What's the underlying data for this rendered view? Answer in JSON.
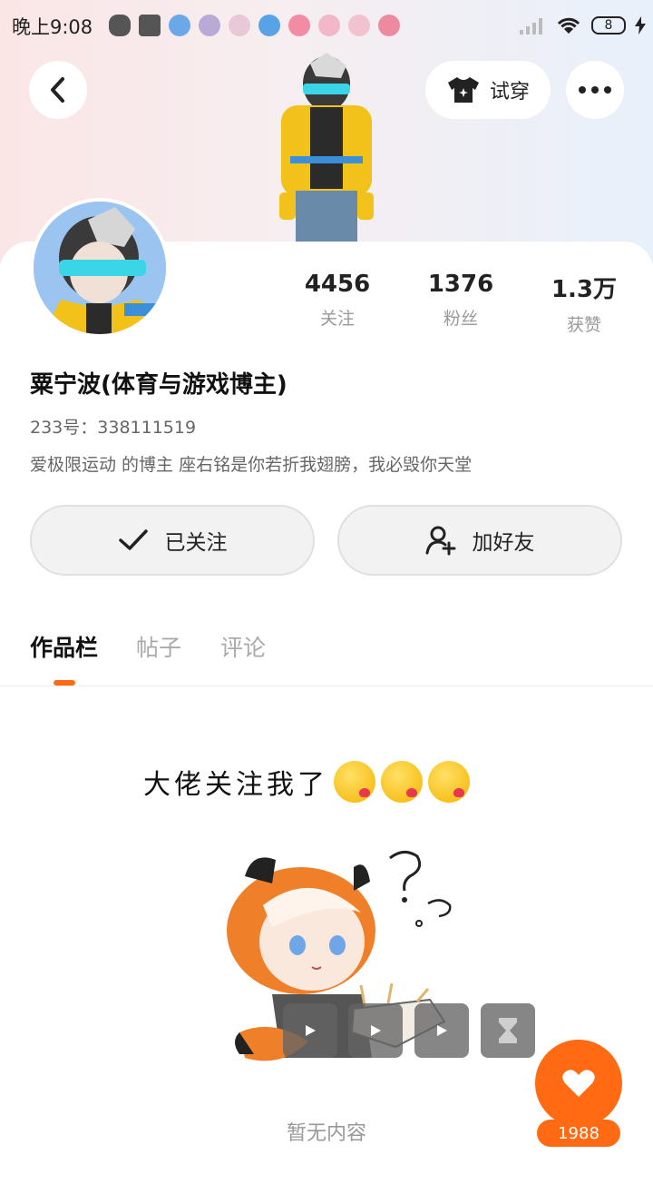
{
  "status_bar": {
    "time": "晚上9:08",
    "battery": "8",
    "app_icons": [
      "wechat-icon",
      "mi-icon",
      "app-icon-1",
      "app-icon-2",
      "app-icon-3",
      "app-icon-4",
      "app-icon-5",
      "app-icon-6",
      "app-icon-7",
      "app-icon-8"
    ]
  },
  "header": {
    "try_on_label": "试穿"
  },
  "profile": {
    "name": "粟宁波(体育与游戏博主)",
    "uid": "233号：338111519",
    "bio": "爱极限运动 的博主 座右铭是你若折我翅膀，我必毁你天堂",
    "stats": [
      {
        "value": "4456",
        "label": "关注"
      },
      {
        "value": "1376",
        "label": "粉丝"
      },
      {
        "value": "1.3万",
        "label": "获赞"
      }
    ]
  },
  "actions": {
    "followed_label": "已关注",
    "add_friend_label": "加好友"
  },
  "tabs": [
    {
      "label": "作品栏",
      "active": true
    },
    {
      "label": "帖子",
      "active": false
    },
    {
      "label": "评论",
      "active": false
    }
  ],
  "empty_state": {
    "caption": "大佬关注我了",
    "text": "暂无内容"
  },
  "like": {
    "count": "1988"
  },
  "colors": {
    "accent": "#ff6a13",
    "muted_text": "#999999"
  }
}
